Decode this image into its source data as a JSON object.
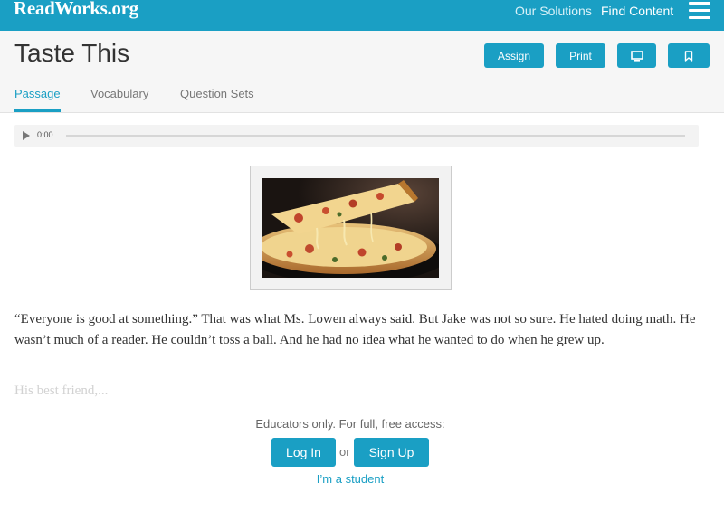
{
  "header_nav": {
    "logo": "ReadWorks.org",
    "links": [
      "Our Solutions",
      "Find Content"
    ],
    "menu_icon": "hamburger-menu-icon"
  },
  "article": {
    "title": "Taste This",
    "buttons": {
      "assign": "Assign",
      "print": "Print",
      "present_icon": "monitor-icon",
      "bookmark_icon": "bookmark-icon"
    },
    "tabs": [
      "Passage",
      "Vocabulary",
      "Question Sets"
    ],
    "active_tab": "Passage"
  },
  "audio": {
    "time": "0:00",
    "progress": 0,
    "play_icon": "play-icon"
  },
  "image": {
    "subject": "pizza slice"
  },
  "passage": {
    "paragraph": "“Everyone is good at something.” That was what Ms. Lowen always said. But Jake was not so sure. He hated doing math. He wasn’t much of a reader. He couldn’t toss a ball. And he had no idea what he wanted to do when he grew up.",
    "faded": "His best friend,..."
  },
  "access": {
    "message": "Educators only. For full, free access:",
    "login": "Log In",
    "or": "or",
    "signup": "Sign Up",
    "student": "I’m a student"
  },
  "colors": {
    "brand": "#1a9fc4",
    "header_bg": "#f6f6f6"
  }
}
